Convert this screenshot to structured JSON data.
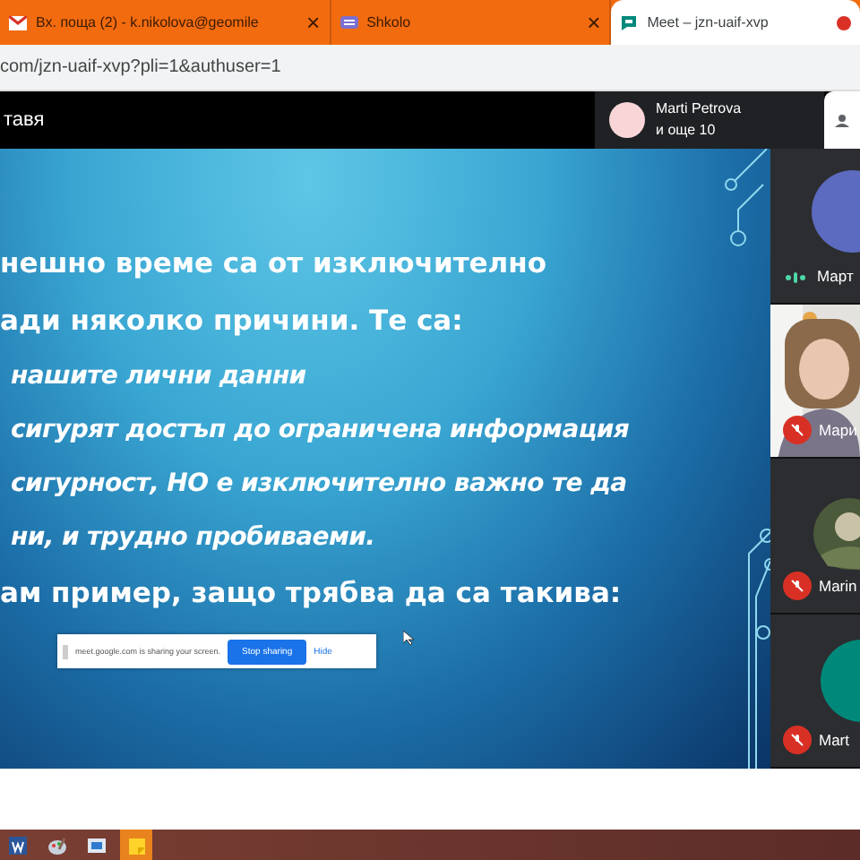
{
  "browser_tabs": [
    {
      "title": "Вх. поща (2) - k.nikolova@geomile",
      "close": "×",
      "kind": "mail",
      "selected": false
    },
    {
      "title": "Shkolo",
      "close": "×",
      "kind": "site",
      "selected": false
    },
    {
      "title": "Meet – jzn-uaif-xvp",
      "kind": "meet",
      "selected": true
    }
  ],
  "address_bar": {
    "url": "com/jzn-uaif-xvp?pli=1&authuser=1"
  },
  "meet_bar": {
    "title": "тавя",
    "presenter": {
      "name": "Marti Petrova",
      "others": "и още 10"
    }
  },
  "slide": {
    "lines": [
      {
        "text": "нешно време са от изключително",
        "kind": "heading"
      },
      {
        "text": "ади няколко причини. Те са:",
        "kind": "heading"
      },
      {
        "text": "нашите лични данни",
        "kind": "bullet"
      },
      {
        "text": "сигурят достъп до ограничена информация",
        "kind": "bullet"
      },
      {
        "text": "сигурност, НО е изключително важно те да",
        "kind": "bullet"
      },
      {
        "text": "ни, и трудно пробиваеми.",
        "kind": "bullet"
      },
      {
        "text": "ам пример, защо трябва да са такива:",
        "kind": "heading"
      }
    ]
  },
  "share_banner": {
    "message": "meet.google.com is sharing your screen.",
    "stop": "Stop sharing",
    "hide": "Hide"
  },
  "participants": [
    {
      "name": "Март",
      "muted": false,
      "kind": "avatar"
    },
    {
      "name": "Мари",
      "muted": true,
      "kind": "video"
    },
    {
      "name": "Marin",
      "muted": true
    },
    {
      "name": "Mart",
      "muted": true,
      "kind": "letter"
    }
  ],
  "taskbar": [
    {
      "kind": "word",
      "selected": false
    },
    {
      "kind": "paint",
      "selected": false
    },
    {
      "kind": "window",
      "selected": false
    },
    {
      "kind": "notes",
      "selected": true
    }
  ]
}
